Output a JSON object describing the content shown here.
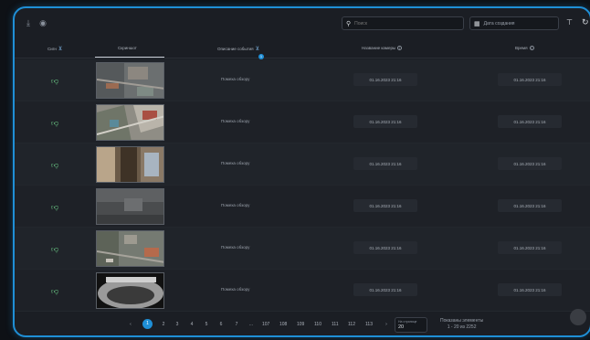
{
  "toolbar": {
    "download_icon": "download-icon",
    "eye_icon": "eye-icon",
    "search_placeholder": "Поиск",
    "date_label": "Дата создания",
    "filter_icon": "filter-clear-icon",
    "refresh_icon": "refresh-icon"
  },
  "columns": {
    "signal": "Сигн",
    "snapshot": "Скриншот",
    "description": "Описание события",
    "description_badge": "1",
    "camera_time": "Название камеры",
    "time": "Время"
  },
  "rows": [
    {
      "description": "Помеха обзору",
      "camera_time": "01.16.2023 21:16",
      "time": "01.16.2023 21:16"
    },
    {
      "description": "Помеха обзору",
      "camera_time": "01.16.2023 21:16",
      "time": "01.16.2023 21:16"
    },
    {
      "description": "Помеха обзору",
      "camera_time": "01.16.2023 21:16",
      "time": "01.16.2023 21:16"
    },
    {
      "description": "Помеха обзору",
      "camera_time": "01.16.2023 21:16",
      "time": "01.16.2023 21:16"
    },
    {
      "description": "Помеха обзору",
      "camera_time": "01.16.2023 21:16",
      "time": "01.16.2023 21:16"
    },
    {
      "description": "Помеха обзору",
      "camera_time": "01.16.2023 21:16",
      "time": "01.16.2023 21:16"
    }
  ],
  "pagination": {
    "prev": "‹",
    "pages": [
      "1",
      "2",
      "3",
      "4",
      "5",
      "6",
      "7",
      "...",
      "107",
      "108",
      "109",
      "110",
      "111",
      "112",
      "113"
    ],
    "next": "›",
    "current": "1",
    "per_page_label": "На странице",
    "per_page_value": "20",
    "shown_label": "Показаны элементы",
    "shown_range": "1 - 20 из 2252"
  },
  "colors": {
    "accent": "#1f8fd6",
    "thumb": "#6fd08a"
  }
}
